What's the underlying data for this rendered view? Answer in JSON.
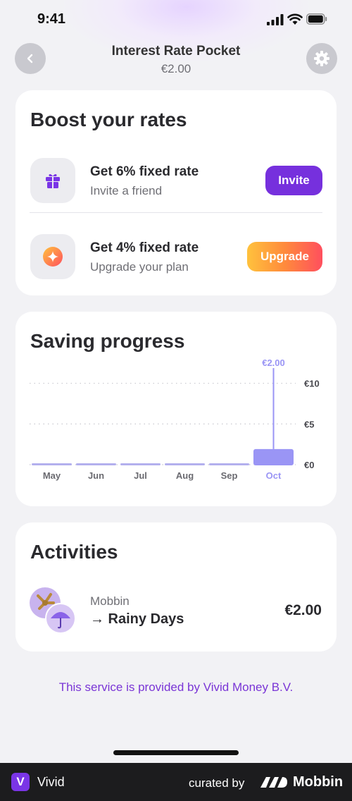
{
  "status_bar": {
    "time": "9:41"
  },
  "nav": {
    "title": "Interest Rate Pocket",
    "subtitle": "€2.00",
    "back_icon": "chevron-left-icon",
    "settings_icon": "gear-icon"
  },
  "boost": {
    "title": "Boost your rates",
    "offers": [
      {
        "title": "Get 6% fixed rate",
        "subtitle": "Invite a friend",
        "button": "Invite",
        "icon": "gift-icon"
      },
      {
        "title": "Get 4% fixed rate",
        "subtitle": "Upgrade your plan",
        "button": "Upgrade",
        "icon": "sparkle-icon"
      }
    ]
  },
  "saving": {
    "title": "Saving progress"
  },
  "chart_data": {
    "type": "bar",
    "categories": [
      "May",
      "Jun",
      "Jul",
      "Aug",
      "Sep",
      "Oct"
    ],
    "values": [
      0,
      0,
      0,
      0,
      0,
      2
    ],
    "highlighted": "Oct",
    "highlight_label": "€2.00",
    "y_ticks": [
      "€10",
      "€5",
      "€0"
    ],
    "y_tick_values": [
      10,
      5,
      0
    ],
    "ylim": [
      0,
      11
    ],
    "grid": true
  },
  "activities": {
    "title": "Activities",
    "items": [
      {
        "name": "Mobbin",
        "description": "→ Rainy Days",
        "amount": "€2.00"
      }
    ]
  },
  "provided_by": "This service is provided by Vivid Money B.V.",
  "footer": {
    "brand_letter": "V",
    "brand": "Vivid",
    "curated": "curated by",
    "mobbin": "Mobbin"
  },
  "colors": {
    "accent": "#7630dd",
    "bar": "#9a95f5",
    "bar_base": "#b3b0ee"
  }
}
